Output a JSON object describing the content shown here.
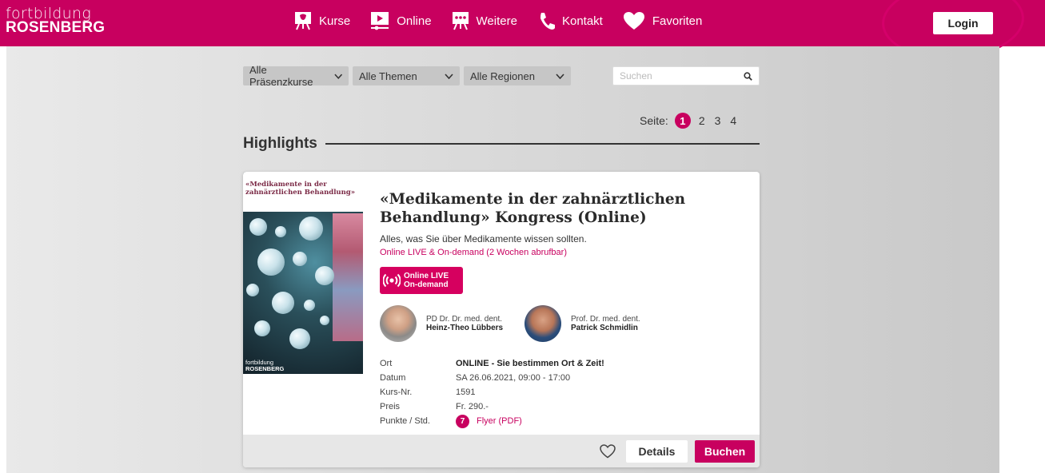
{
  "colors": {
    "brand": "#c8005f",
    "background": "#d6d6d6"
  },
  "header": {
    "logo_line1": "fortbildung",
    "logo_line2": "ROSENBERG",
    "nav": [
      {
        "label": "Kurse",
        "icon": "presentation-board-icon"
      },
      {
        "label": "Online",
        "icon": "video-play-icon"
      },
      {
        "label": "Weitere",
        "icon": "presentation-more-icon"
      },
      {
        "label": "Kontakt",
        "icon": "phone-icon"
      },
      {
        "label": "Favoriten",
        "icon": "heart-icon"
      }
    ],
    "login_label": "Login"
  },
  "filters": {
    "type": "Alle Präsenzkurse",
    "topics": "Alle Themen",
    "regions": "Alle Regionen",
    "search_placeholder": "Suchen"
  },
  "pagination": {
    "label": "Seite:",
    "pages": [
      "1",
      "2",
      "3",
      "4"
    ],
    "current": "1"
  },
  "section_title": "Highlights",
  "course": {
    "cover_title": "«Medikamente in der zahnärztlichen Behandlung»",
    "cover_logo_line1": "fortbildung",
    "cover_logo_line2": "ROSENBERG",
    "title": "«Medikamente in der zahnärztlichen Behandlung» Kongress (Online)",
    "description": "Alles, was Sie über Medikamente wissen sollten.",
    "mode": "Online LIVE & On-demand (2 Wochen abrufbar)",
    "badge_line1": "Online LIVE",
    "badge_line2": "On-demand",
    "speakers": [
      {
        "title": "PD Dr. Dr. med. dent.",
        "name": "Heinz-Theo Lübbers"
      },
      {
        "title": "Prof. Dr. med. dent.",
        "name": "Patrick Schmidlin"
      }
    ],
    "info": [
      {
        "label": "Ort",
        "value": "ONLINE - Sie bestimmen Ort & Zeit!"
      },
      {
        "label": "Datum",
        "value": "SA 26.06.2021, 09:00 - 17:00"
      },
      {
        "label": "Kurs-Nr.",
        "value": "1591"
      },
      {
        "label": "Preis",
        "value": "Fr. 290.-"
      }
    ],
    "points_label": "Punkte / Std.",
    "points_value": "7",
    "flyer_label": "Flyer (PDF)",
    "details_label": "Details",
    "book_label": "Buchen"
  }
}
